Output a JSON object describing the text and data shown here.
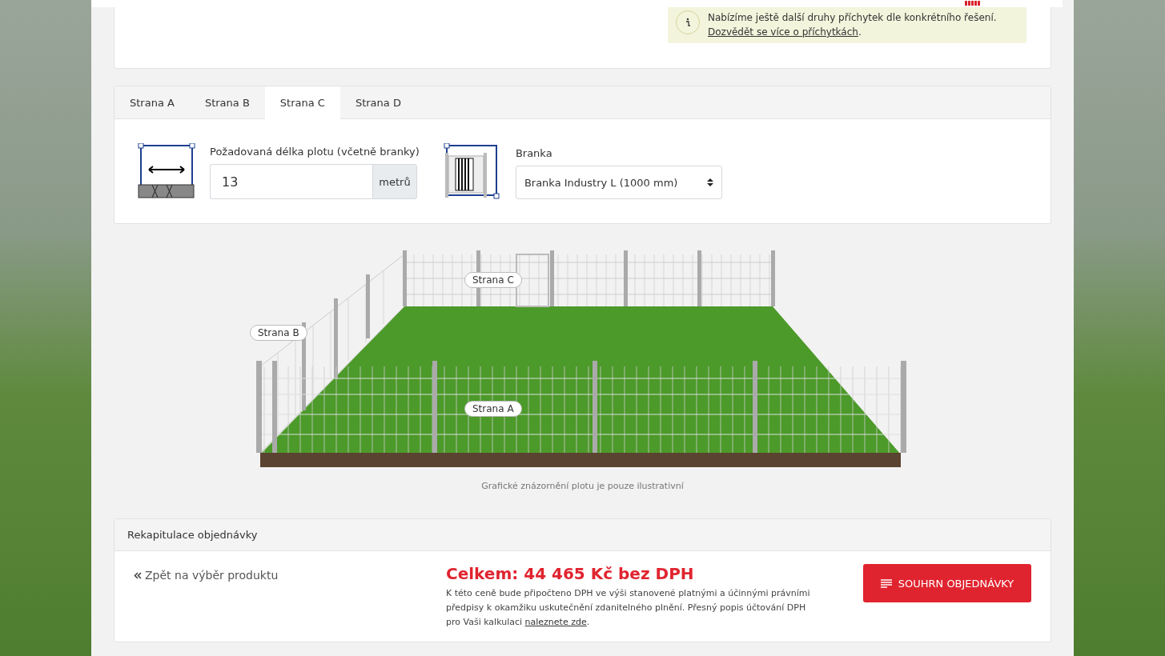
{
  "notice": {
    "text": "Nabízíme ještě další druhy příchytek dle konkrétního řešení.",
    "link": "Dozvědět se více o příchytkách",
    "after": "."
  },
  "tabs": [
    {
      "label": "Strana A",
      "selected": false
    },
    {
      "label": "Strana B",
      "selected": false
    },
    {
      "label": "Strana C",
      "selected": true
    },
    {
      "label": "Strana D",
      "selected": false
    }
  ],
  "length": {
    "label": "Požadovaná délka plotu (včetně branky)",
    "value": "13",
    "unit": "metrů"
  },
  "gate": {
    "label": "Branka",
    "value": "Branka Industry L (1000 mm)"
  },
  "illustration": {
    "side_labels": [
      "Strana C",
      "Strana B",
      "Strana A"
    ],
    "caption": "Grafické znázornění plotu je pouze ilustrativní"
  },
  "summary": {
    "title": "Rekapitulace objednávky",
    "back_link": "Zpět na výběr produktu",
    "total": "Celkem: 44 465 Kč bez DPH",
    "note_before": "K této ceně bude připočteno DPH ve výši stanovené platnými a účinnými právními předpisy k okamžiku uskutečnění zdanitelného plnění. Přesný popis účtování DPH pro Vaši kalkulaci ",
    "note_link": "naleznete zde",
    "note_after": ".",
    "button": "SOUHRN OBJEDNÁVKY"
  }
}
